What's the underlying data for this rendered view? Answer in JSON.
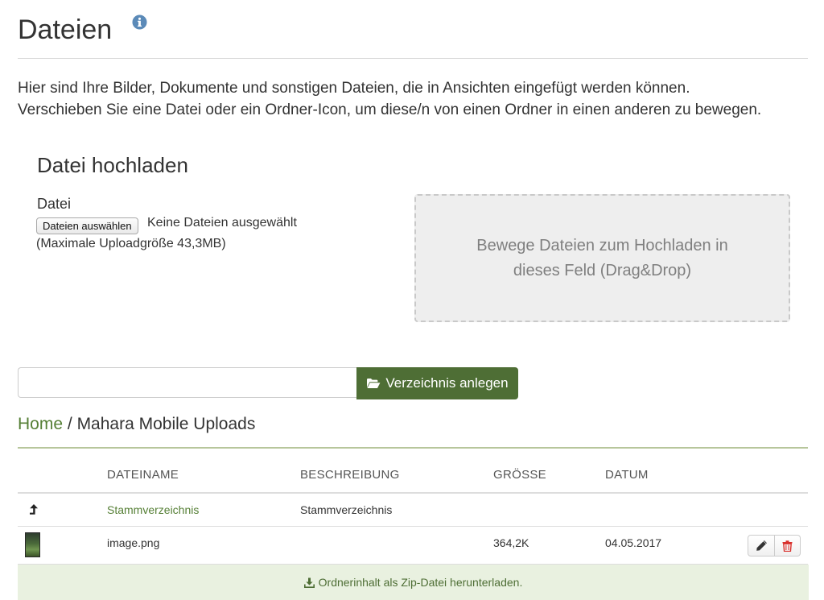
{
  "header": {
    "title": "Dateien"
  },
  "intro": {
    "line1": "Hier sind Ihre Bilder, Dokumente und sonstigen Dateien, die in Ansichten eingefügt werden können.",
    "line2": "Verschieben Sie eine Datei oder ein Ordner-Icon, um diese/n von einen Ordner in einen anderen zu bewegen."
  },
  "upload": {
    "title": "Datei hochladen",
    "file_label": "Datei",
    "choose_button": "Dateien auswählen",
    "status": "Keine Dateien ausgewählt",
    "max_size": "(Maximale Uploadgröße 43,3MB)",
    "dropzone_line1": "Bewege Dateien zum Hochladen in",
    "dropzone_line2": "dieses Feld (Drag&Drop)"
  },
  "folder": {
    "input_value": "",
    "create_button": "Verzeichnis anlegen"
  },
  "breadcrumb": {
    "home": "Home",
    "separator": "/",
    "current": "Mahara Mobile Uploads"
  },
  "table": {
    "columns": [
      "DATEINAME",
      "BESCHREIBUNG",
      "GRÖSSE",
      "DATUM"
    ],
    "rows": [
      {
        "name": "Stammverzeichnis",
        "description": "Stammverzeichnis",
        "size": "",
        "date": ""
      },
      {
        "name": "image.png",
        "description": "",
        "size": "364,2K",
        "date": "04.05.2017"
      }
    ]
  },
  "download": {
    "label": "Ordnerinhalt als Zip-Datei herunterladen."
  },
  "icons": {
    "info": "info-circle-icon",
    "folder_open": "folder-open-icon",
    "level_up": "level-up-icon",
    "edit": "pencil-icon",
    "delete": "trash-icon",
    "download": "download-icon"
  },
  "colors": {
    "primary_green": "#4e6e35",
    "link_green": "#557f35",
    "info_blue": "#5b8ab8",
    "delete_red": "#d9302c",
    "zip_bar_bg": "#e9f1e0",
    "dropzone_bg": "#eeeeee"
  }
}
